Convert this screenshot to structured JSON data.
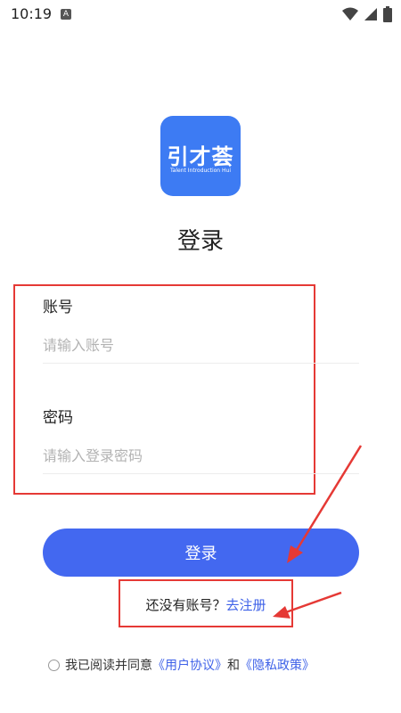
{
  "status_bar": {
    "time": "10:19",
    "notification_glyph": "A",
    "icons": [
      "wifi-icon",
      "signal-icon",
      "battery-icon"
    ]
  },
  "logo": {
    "main_text": "引才荟",
    "sub_text": "Talent Introduction Hui",
    "color": "#3d7bf3"
  },
  "title": "登录",
  "form": {
    "account": {
      "label": "账号",
      "placeholder": "请输入账号"
    },
    "password": {
      "label": "密码",
      "placeholder": "请输入登录密码"
    }
  },
  "login_button": {
    "label": "登录",
    "color": "#4368f0"
  },
  "register": {
    "prompt": "还没有账号？",
    "link": "去注册"
  },
  "agreement": {
    "prefix": "我已阅读并同意",
    "user_agreement": "《用户协议》",
    "and": "和",
    "privacy_policy": "《隐私政策》"
  },
  "colors": {
    "annotation_red": "#e53935",
    "link_blue": "#3f62e8"
  }
}
